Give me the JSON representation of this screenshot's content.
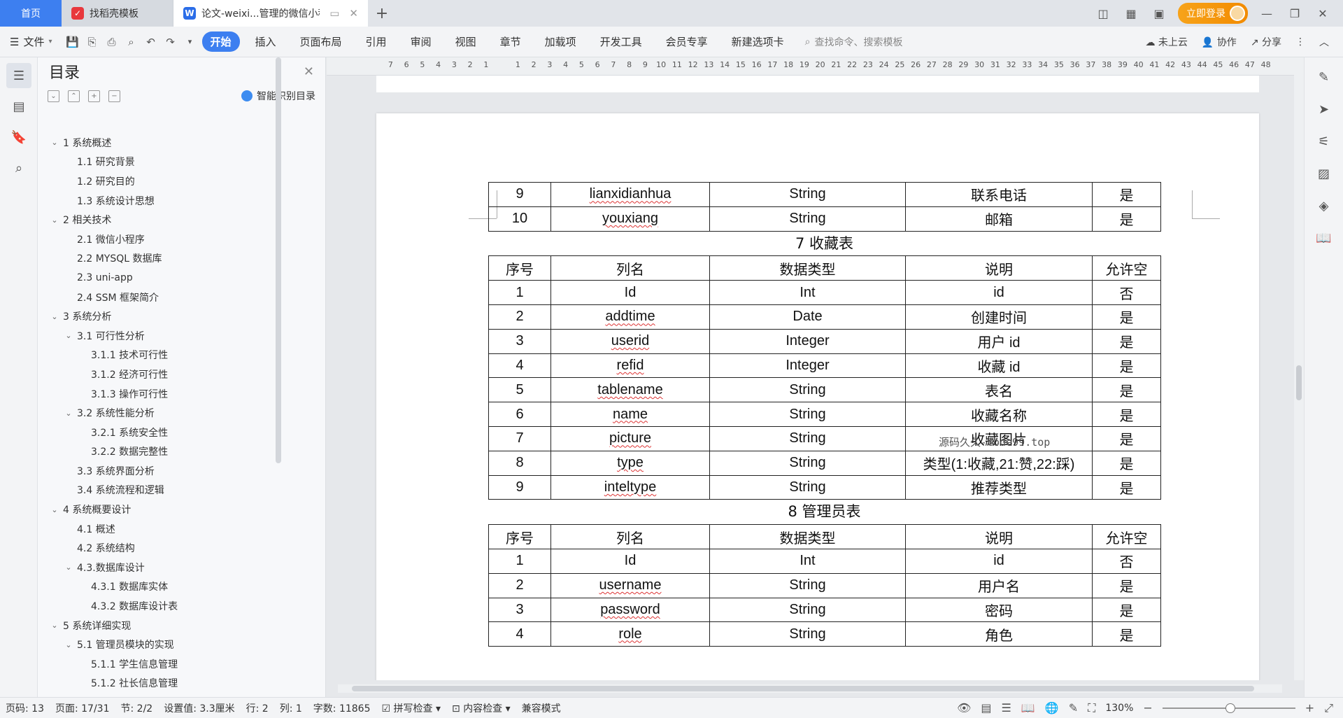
{
  "tabs": [
    {
      "label": "首页"
    },
    {
      "label": "找稻壳模板",
      "icon": "docer-icon"
    },
    {
      "label": "论文-weixi...管理的微信小程序",
      "icon": "wps-writer-icon"
    }
  ],
  "tabbar": {
    "login_label": "立即登录"
  },
  "ribbon": {
    "file_label": "文件",
    "tabs": [
      "开始",
      "插入",
      "页面布局",
      "引用",
      "审阅",
      "视图",
      "章节",
      "加载项",
      "开发工具",
      "会员专享",
      "新建选项卡"
    ],
    "search_placeholder": "查找命令、搜索模板",
    "cloud_label": "未上云",
    "collab_label": "协作",
    "share_label": "分享"
  },
  "toc": {
    "title": "目录",
    "smart_label": "智能识别目录",
    "items": [
      {
        "label": "1 系统概述",
        "level": 1
      },
      {
        "label": "1.1  研究背景",
        "level": 2
      },
      {
        "label": "1.2 研究目的",
        "level": 2
      },
      {
        "label": "1.3 系统设计思想",
        "level": 2
      },
      {
        "label": "2 相关技术",
        "level": 1
      },
      {
        "label": "2.1 微信小程序",
        "level": 2
      },
      {
        "label": "2.2 MYSQL 数据库",
        "level": 2
      },
      {
        "label": "2.3 uni-app",
        "level": 2
      },
      {
        "label": "2.4 SSM 框架简介",
        "level": 2
      },
      {
        "label": "3 系统分析",
        "level": 1
      },
      {
        "label": "3.1 可行性分析",
        "level": 2
      },
      {
        "label": "3.1.1 技术可行性",
        "level": 3
      },
      {
        "label": "3.1.2 经济可行性",
        "level": 3
      },
      {
        "label": "3.1.3 操作可行性",
        "level": 3
      },
      {
        "label": "3.2 系统性能分析",
        "level": 2
      },
      {
        "label": "3.2.1  系统安全性",
        "level": 3
      },
      {
        "label": "3.2.2  数据完整性",
        "level": 3
      },
      {
        "label": "3.3 系统界面分析",
        "level": 2
      },
      {
        "label": "3.4 系统流程和逻辑",
        "level": 2
      },
      {
        "label": "4 系统概要设计",
        "level": 1
      },
      {
        "label": "4.1 概述",
        "level": 2
      },
      {
        "label": "4.2 系统结构",
        "level": 2
      },
      {
        "label": "4.3.数据库设计",
        "level": 2
      },
      {
        "label": "4.3.1 数据库实体",
        "level": 3
      },
      {
        "label": "4.3.2 数据库设计表",
        "level": 3
      },
      {
        "label": "5 系统详细实现",
        "level": 1
      },
      {
        "label": "5.1  管理员模块的实现",
        "level": 2
      },
      {
        "label": "5.1.1  学生信息管理",
        "level": 3
      },
      {
        "label": "5.1.2  社长信息管理",
        "level": 3
      }
    ]
  },
  "ruler": {
    "numbers": [
      "7",
      "6",
      "5",
      "4",
      "3",
      "2",
      "1",
      "",
      "1",
      "2",
      "3",
      "4",
      "5",
      "6",
      "7",
      "8",
      "9",
      "10",
      "11",
      "12",
      "13",
      "14",
      "15",
      "16",
      "17",
      "18",
      "19",
      "20",
      "21",
      "22",
      "23",
      "24",
      "25",
      "26",
      "27",
      "28",
      "29",
      "30",
      "31",
      "32",
      "33",
      "34",
      "35",
      "36",
      "37",
      "38",
      "39",
      "40",
      "41",
      "42",
      "43",
      "44",
      "45",
      "46",
      "47",
      "48"
    ]
  },
  "document": {
    "table_prev_rows": [
      [
        "9",
        "lianxidianhua",
        "String",
        "联系电话",
        "是"
      ],
      [
        "10",
        "youxiang",
        "String",
        "邮箱",
        "是"
      ]
    ],
    "table7_caption": "7 收藏表",
    "headers": [
      "序号",
      "列名",
      "数据类型",
      "说明",
      "允许空"
    ],
    "table7_rows": [
      [
        "1",
        "Id",
        "Int",
        "id",
        "否"
      ],
      [
        "2",
        "addtime",
        "Date",
        "创建时间",
        "是"
      ],
      [
        "3",
        "userid",
        "Integer",
        "用户 id",
        "是"
      ],
      [
        "4",
        "refid",
        "Integer",
        "收藏 id",
        "是"
      ],
      [
        "5",
        "tablename",
        "String",
        "表名",
        "是"
      ],
      [
        "6",
        "name",
        "String",
        "收藏名称",
        "是"
      ],
      [
        "7",
        "picture",
        "String",
        "收藏图片",
        "是"
      ],
      [
        "8",
        "type",
        "String",
        "类型(1:收藏,21:赞,22:踩)",
        "是"
      ],
      [
        "9",
        "inteltype",
        "String",
        "推荐类型",
        "是"
      ]
    ],
    "table8_caption": "8 管理员表",
    "table8_rows": [
      [
        "1",
        "Id",
        "Int",
        "id",
        "否"
      ],
      [
        "2",
        "username",
        "String",
        "用户名",
        "是"
      ],
      [
        "3",
        "password",
        "String",
        "密码",
        "是"
      ],
      [
        "4",
        "role",
        "String",
        "角色",
        "是"
      ]
    ],
    "watermark": "源码久久-code99.top"
  },
  "status": {
    "page_code": "页码: 13",
    "page": "页面: 17/31",
    "section": "节: 2/2",
    "setting": "设置值: 3.3厘米",
    "row": "行: 2",
    "col": "列: 1",
    "words": "字数: 11865",
    "spell": "拼写检查",
    "content_check": "内容检查",
    "compat": "兼容模式",
    "zoom": "130%"
  }
}
